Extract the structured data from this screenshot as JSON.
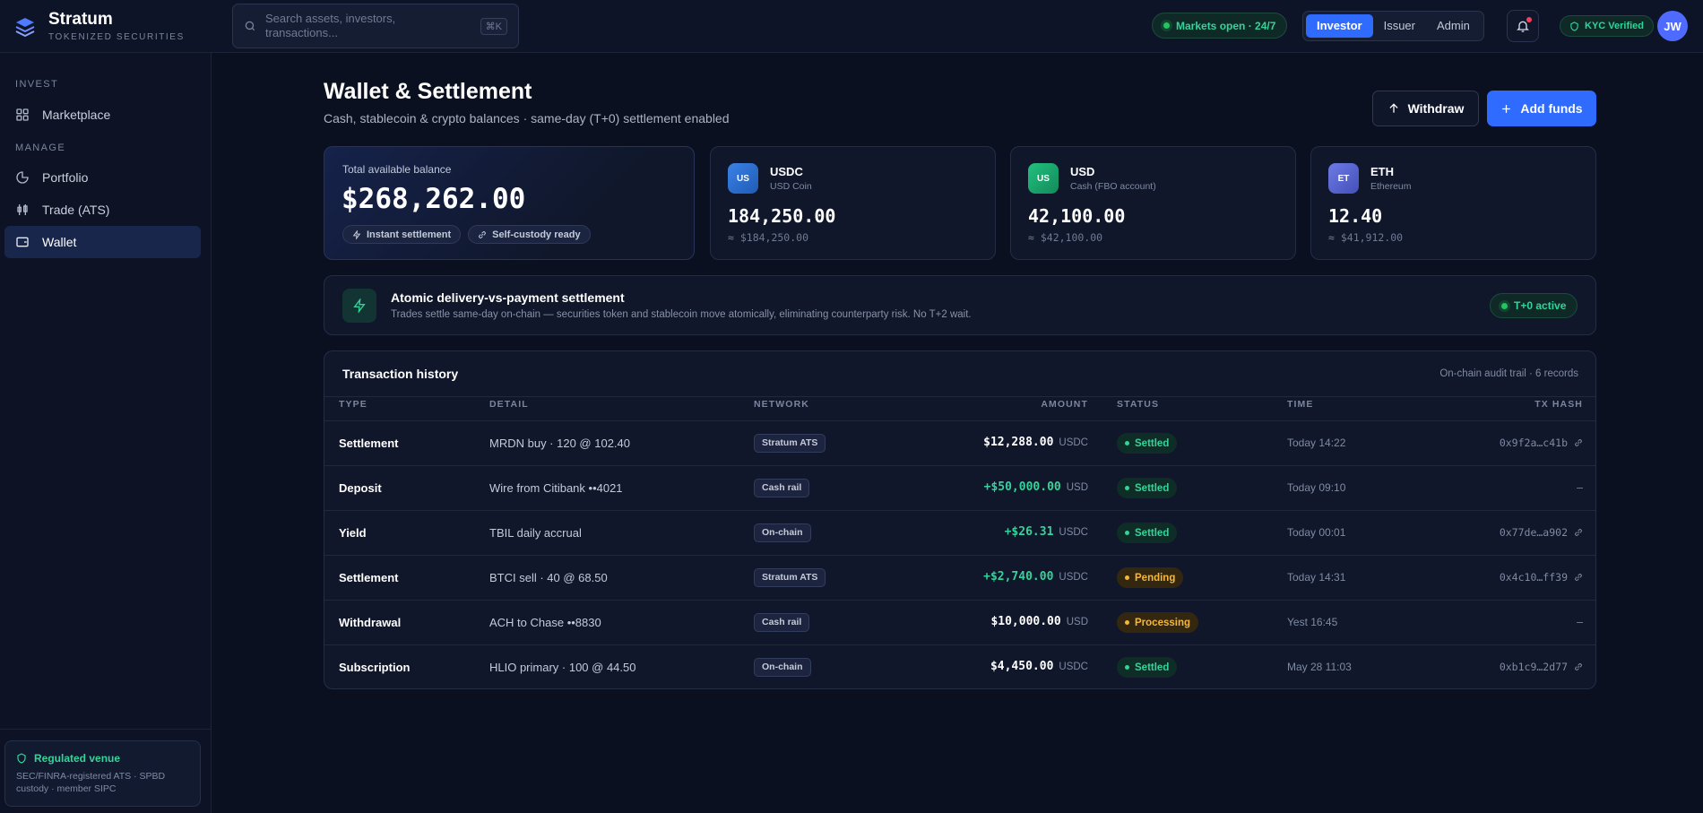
{
  "brand": {
    "name": "Stratum",
    "subtitle": "TOKENIZED SECURITIES"
  },
  "search": {
    "placeholder": "Search assets, investors, transactions...",
    "shortcut": "⌘K"
  },
  "header": {
    "markets_status": "Markets open · 24/7",
    "roles": [
      "Investor",
      "Issuer",
      "Admin"
    ],
    "active_role": "Investor",
    "kyc": "KYC Verified",
    "avatar_initials": "JW"
  },
  "sidebar": {
    "sections": [
      {
        "label": "INVEST",
        "items": [
          {
            "label": "Marketplace",
            "icon": "grid-icon"
          }
        ]
      },
      {
        "label": "MANAGE",
        "items": [
          {
            "label": "Portfolio",
            "icon": "pie-chart-icon"
          },
          {
            "label": "Trade (ATS)",
            "icon": "candlestick-icon"
          },
          {
            "label": "Wallet",
            "icon": "wallet-icon",
            "active": true
          }
        ]
      }
    ],
    "regulated": {
      "title": "Regulated venue",
      "text": "SEC/FINRA-registered ATS · SPBD custody · member SIPC"
    }
  },
  "page": {
    "title": "Wallet & Settlement",
    "subtitle": "Cash, stablecoin & crypto balances · same-day (T+0) settlement enabled",
    "withdraw_label": "Withdraw",
    "add_funds_label": "Add funds"
  },
  "total_balance": {
    "label": "Total available balance",
    "value": "$268,262.00",
    "chips": [
      "Instant settlement",
      "Self-custody ready"
    ]
  },
  "assets": [
    {
      "badge": "US",
      "symbol": "USDC",
      "name": "USD Coin",
      "balance": "184,250.00",
      "usd": "≈ $184,250.00",
      "color": "#2a6fd8"
    },
    {
      "badge": "US",
      "symbol": "USD",
      "name": "Cash (FBO account)",
      "balance": "42,100.00",
      "usd": "≈ $42,100.00",
      "color": "#17a36b"
    },
    {
      "badge": "ET",
      "symbol": "ETH",
      "name": "Ethereum",
      "balance": "12.40",
      "usd": "≈ $41,912.00",
      "color": "#5a67d8"
    }
  ],
  "banner": {
    "title": "Atomic delivery-vs-payment settlement",
    "text": "Trades settle same-day on-chain — securities token and stablecoin move atomically, eliminating counterparty risk. No T+2 wait.",
    "badge": "T+0 active"
  },
  "transactions": {
    "title": "Transaction history",
    "meta": "On-chain audit trail · 6 records",
    "columns": [
      "TYPE",
      "DETAIL",
      "NETWORK",
      "AMOUNT",
      "STATUS",
      "TIME",
      "TX HASH"
    ],
    "rows": [
      {
        "type": "Settlement",
        "detail": "MRDN buy · 120 @ 102.40",
        "network": "Stratum ATS",
        "amount": "$12,288.00",
        "currency": "USDC",
        "status": "Settled",
        "time": "Today 14:22",
        "hash": "0x9f2a…c41b"
      },
      {
        "type": "Deposit",
        "detail": "Wire from Citibank ••4021",
        "network": "Cash rail",
        "amount": "+$50,000.00",
        "currency": "USD",
        "status": "Settled",
        "time": "Today 09:10",
        "hash": "—"
      },
      {
        "type": "Yield",
        "detail": "TBIL daily accrual",
        "network": "On-chain",
        "amount": "+$26.31",
        "currency": "USDC",
        "status": "Settled",
        "time": "Today 00:01",
        "hash": "0x77de…a902"
      },
      {
        "type": "Settlement",
        "detail": "BTCI sell · 40 @ 68.50",
        "network": "Stratum ATS",
        "amount": "+$2,740.00",
        "currency": "USDC",
        "status": "Pending",
        "time": "Today 14:31",
        "hash": "0x4c10…ff39"
      },
      {
        "type": "Withdrawal",
        "detail": "ACH to Chase ••8830",
        "network": "Cash rail",
        "amount": "$10,000.00",
        "currency": "USD",
        "status": "Processing",
        "time": "Yest 16:45",
        "hash": "—"
      },
      {
        "type": "Subscription",
        "detail": "HLIO primary · 100 @ 44.50",
        "network": "On-chain",
        "amount": "$4,450.00",
        "currency": "USDC",
        "status": "Settled",
        "time": "May 28 11:03",
        "hash": "0xb1c9…2d77"
      }
    ]
  }
}
